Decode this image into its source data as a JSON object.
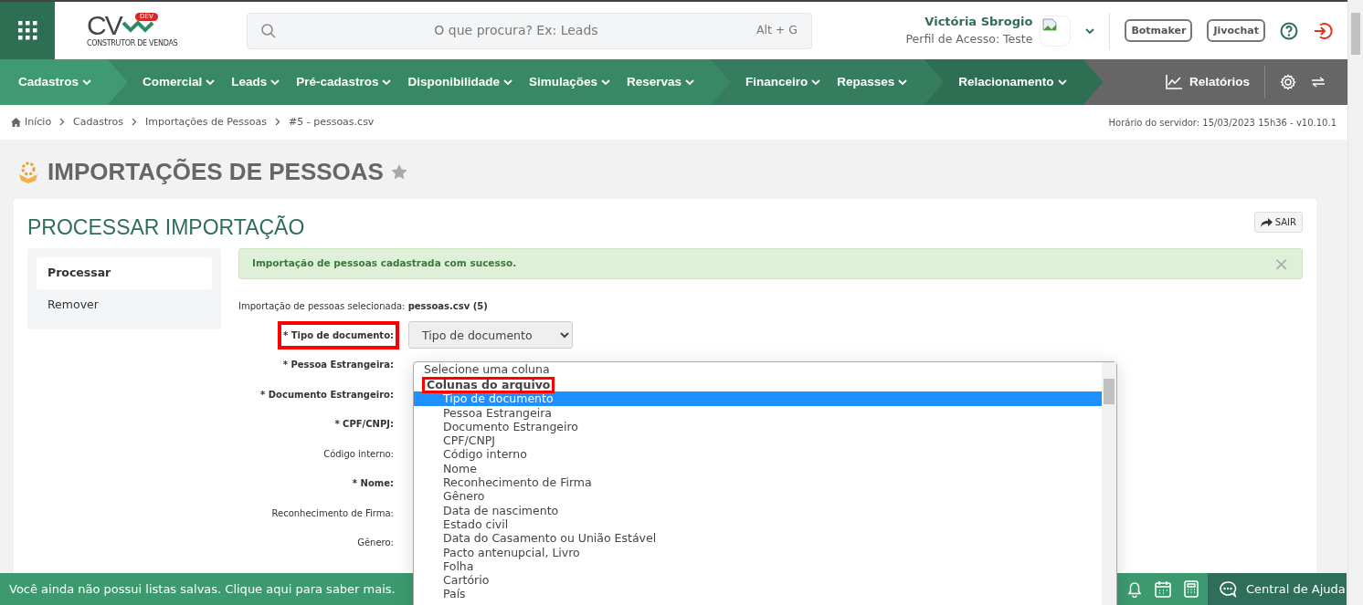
{
  "logo": {
    "letters": "CV",
    "badge": "DEV",
    "tagline": "CONSTRUTOR DE VENDAS"
  },
  "search": {
    "placeholder": "O que procura? Ex: Leads",
    "shortcut": "Alt + G"
  },
  "user": {
    "name": "Victória Sbrogio",
    "profile": "Perfil de Acesso: Teste"
  },
  "header_buttons": [
    "Botmaker",
    "Jivochat"
  ],
  "nav": {
    "groups": [
      {
        "color": "#3f9a74",
        "items": [
          "Cadastros"
        ]
      },
      {
        "color": "#398865",
        "items": [
          "Comercial",
          "Leads",
          "Pré-cadastros",
          "Disponibilidade",
          "Simulações",
          "Reservas"
        ]
      },
      {
        "color": "#357d5e",
        "items": [
          "Financeiro",
          "Repasses"
        ]
      },
      {
        "color": "#2e6e53",
        "items": [
          "Relacionamento"
        ]
      }
    ],
    "reports": "Relatórios"
  },
  "breadcrumb": [
    "Início",
    "Cadastros",
    "Importações de Pessoas",
    "#5 - pessoas.csv"
  ],
  "server_time": "Horário do servidor: 15/03/2023 15h36 - v10.10.1",
  "page_title": "IMPORTAÇÕES DE PESSOAS",
  "favorite": false,
  "card": {
    "title": "PROCESSAR IMPORTAÇÃO",
    "exit_button": "SAIR",
    "sidebar": [
      {
        "label": "Processar",
        "selected": true
      },
      {
        "label": "Remover",
        "selected": false
      }
    ],
    "alert": "Importação de pessoas cadastrada com sucesso.",
    "alert_close": "×",
    "selected_file": "Importação de pessoas selecionada: **pessoas.csv (5)**",
    "fields": [
      {
        "label": "* Tipo de documento:",
        "required": true,
        "highlighted": true,
        "value": "Tipo de documento"
      },
      {
        "label": "* Pessoa Estrangeira:",
        "required": true,
        "highlighted": false
      },
      {
        "label": "* Documento Estrangeiro:",
        "required": true,
        "highlighted": false
      },
      {
        "label": "* CPF/CNPJ:",
        "required": true,
        "highlighted": false
      },
      {
        "label": "Código interno:",
        "required": false,
        "highlighted": false
      },
      {
        "label": "* Nome:",
        "required": true,
        "highlighted": false
      },
      {
        "label": "Reconhecimento de Firma:",
        "required": false,
        "highlighted": false
      },
      {
        "label": "Gênero:",
        "required": false,
        "highlighted": false
      }
    ],
    "dropdown": {
      "placeholder": "Selecione uma coluna",
      "group": "Colunas do arquivo",
      "group_highlighted": true,
      "options": [
        {
          "label": "Tipo de documento",
          "selected": true
        },
        {
          "label": "Pessoa Estrangeira",
          "selected": false
        },
        {
          "label": "Documento Estrangeiro",
          "selected": false
        },
        {
          "label": "CPF/CNPJ",
          "selected": false
        },
        {
          "label": "Código interno",
          "selected": false
        },
        {
          "label": "Nome",
          "selected": false
        },
        {
          "label": "Reconhecimento de Firma",
          "selected": false
        },
        {
          "label": "Gênero",
          "selected": false
        },
        {
          "label": "Data de nascimento",
          "selected": false
        },
        {
          "label": "Estado civil",
          "selected": false
        },
        {
          "label": "Data do Casamento ou União Estável",
          "selected": false
        },
        {
          "label": "Pacto antenupcial, Livro",
          "selected": false
        },
        {
          "label": "Folha",
          "selected": false
        },
        {
          "label": "Cartório",
          "selected": false
        },
        {
          "label": "País",
          "selected": false
        }
      ]
    }
  },
  "bottom_bar": {
    "message": "Você ainda não possui listas salvas. Clique aqui para saber mais.",
    "help": "Central de Ajuda"
  }
}
